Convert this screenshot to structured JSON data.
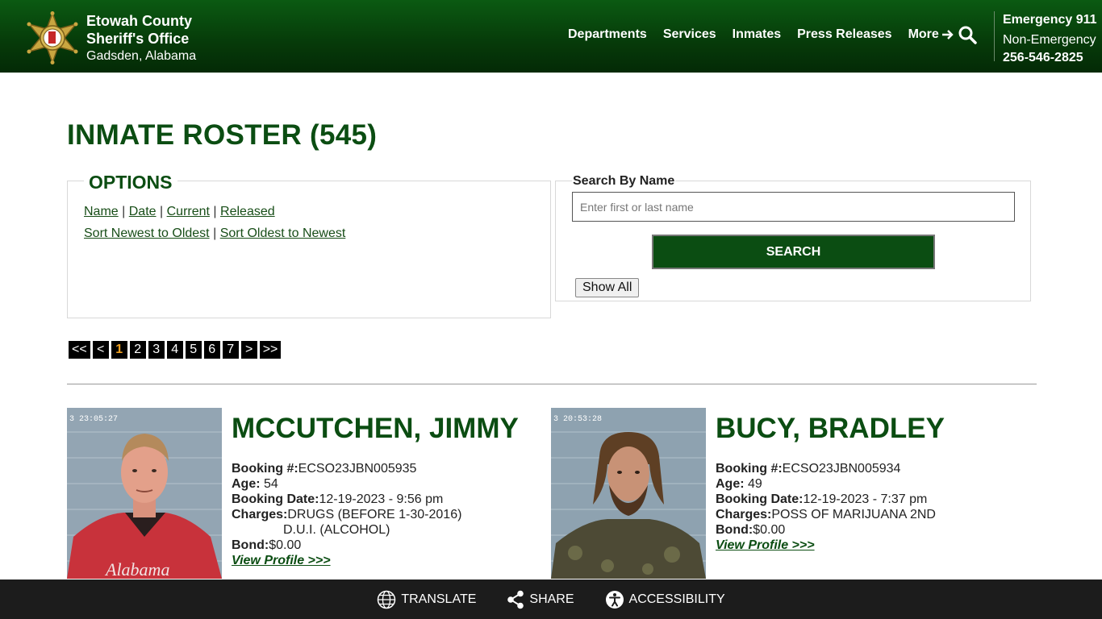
{
  "header": {
    "agency_line1": "Etowah County",
    "agency_line2": "Sheriff's Office",
    "location": "Gadsden, Alabama",
    "nav": [
      "Departments",
      "Services",
      "Inmates",
      "Press Releases",
      "More"
    ],
    "emergency": "Emergency 911",
    "non_emergency_label": "Non-Emergency",
    "non_emergency_phone": "256-546-2825",
    "brand_color": "#0b5a12"
  },
  "page": {
    "title": "INMATE ROSTER (545)"
  },
  "options": {
    "legend": "OPTIONS",
    "filters": [
      "Name",
      "Date",
      "Current",
      "Released"
    ],
    "separator": "|",
    "sort_newest": "Sort Newest to Oldest",
    "sort_oldest": "Sort Oldest to Newest"
  },
  "search": {
    "label": "Search By Name",
    "placeholder": "Enter first or last name",
    "button": "SEARCH",
    "show_all": "Show All"
  },
  "pagination": {
    "first": "<<",
    "prev": "<",
    "pages": [
      "1",
      "2",
      "3",
      "4",
      "5",
      "6",
      "7"
    ],
    "current": "1",
    "next": ">",
    "last": ">>"
  },
  "inmates": [
    {
      "name": "MCCUTCHEN, JIMMY",
      "booking_label": "Booking #:",
      "booking": "ECSO23JBN005935",
      "age_label": "Age:",
      "age": "54",
      "date_label": "Booking Date:",
      "booking_date": "12-19-2023 - 9:56 pm",
      "charges_label": "Charges:",
      "charges": [
        "DRUGS (BEFORE 1-30-2016)",
        "D.U.I. (ALCOHOL)"
      ],
      "bond_label": "Bond:",
      "bond": "$0.00",
      "profile_link": "View Profile >>>",
      "photo_timestamp": "3 23:05:27",
      "shirt_text": "Alabama"
    },
    {
      "name": "BUCY, BRADLEY",
      "booking_label": "Booking #:",
      "booking": "ECSO23JBN005934",
      "age_label": "Age:",
      "age": "49",
      "date_label": "Booking Date:",
      "booking_date": "12-19-2023 - 7:37 pm",
      "charges_label": "Charges:",
      "charges": [
        "POSS OF MARIJUANA 2ND"
      ],
      "bond_label": "Bond:",
      "bond": "$0.00",
      "profile_link": "View Profile >>>",
      "photo_timestamp": "3 20:53:28"
    }
  ],
  "footer": {
    "translate": "TRANSLATE",
    "share": "SHARE",
    "accessibility": "ACCESSIBILITY"
  }
}
